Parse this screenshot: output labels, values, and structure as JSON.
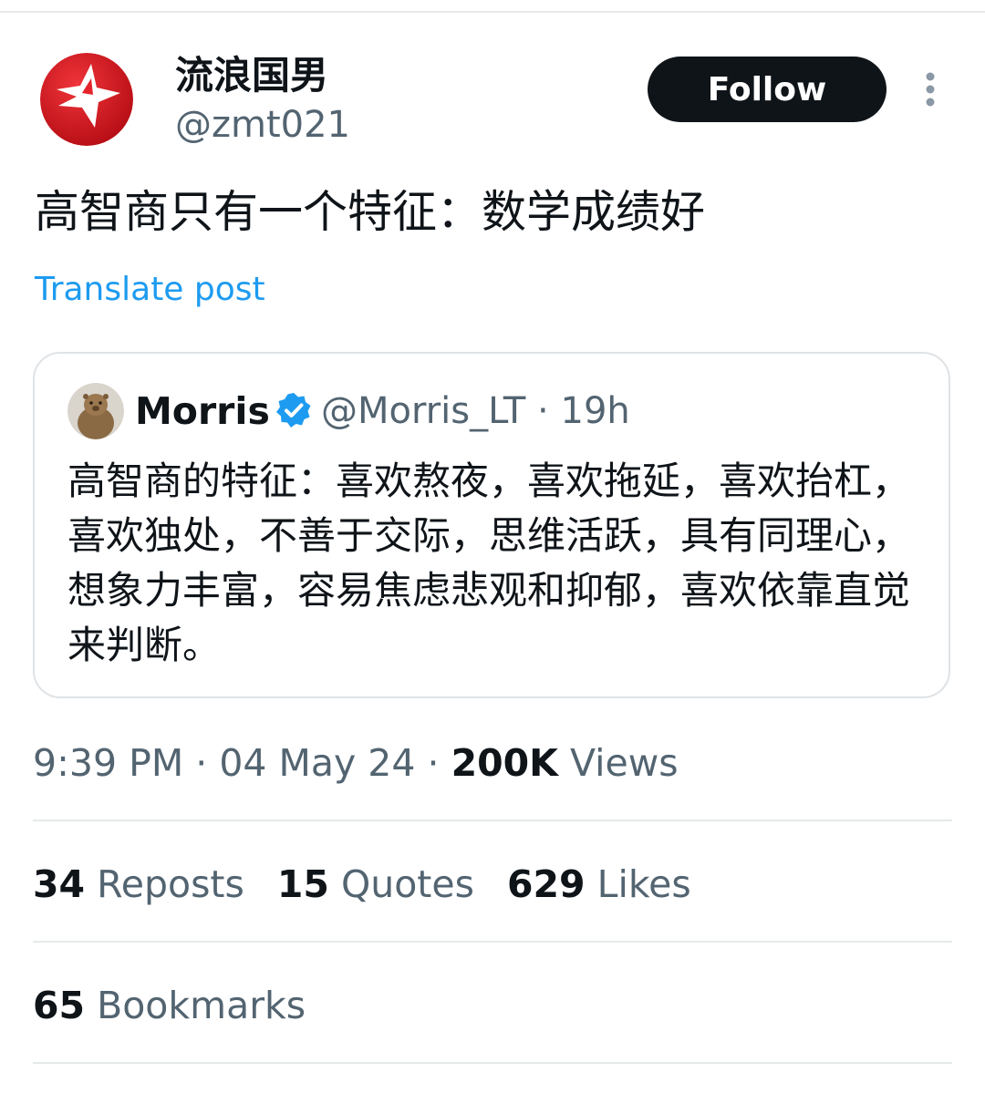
{
  "author": {
    "display_name": "流浪国男",
    "handle": "@zmt021"
  },
  "actions": {
    "follow_label": "Follow"
  },
  "post": {
    "text": "高智商只有一个特征：数学成绩好",
    "translate_label": "Translate post"
  },
  "quoted_post": {
    "display_name": "Morris",
    "handle": "@Morris_LT",
    "separator": " · ",
    "time": "19h",
    "text": "高智商的特征：喜欢熬夜，喜欢拖延，喜欢抬杠，喜欢独处，不善于交际，思维活跃，具有同理心，想象力丰富，容易焦虑悲观和抑郁，喜欢依靠直觉来判断。"
  },
  "meta": {
    "time": "9:39 PM",
    "separator": " · ",
    "date": "04 May 24",
    "views_count": "200K",
    "views_label": " Views"
  },
  "stats": {
    "reposts_count": "34",
    "reposts_label": " Reposts",
    "quotes_count": "15",
    "quotes_label": " Quotes",
    "likes_count": "629",
    "likes_label": " Likes",
    "bookmarks_count": "65",
    "bookmarks_label": " Bookmarks"
  },
  "colors": {
    "accent": "#1d9bf0",
    "text_primary": "#0f1419",
    "text_secondary": "#536471",
    "border": "#dfe3e6",
    "avatar_red": "#d8141b"
  },
  "icons": {
    "author_avatar": "red-star-logo-icon",
    "more": "more-vertical-icon",
    "verified": "verified-badge-icon",
    "quoted_avatar": "marmot-avatar-icon"
  }
}
